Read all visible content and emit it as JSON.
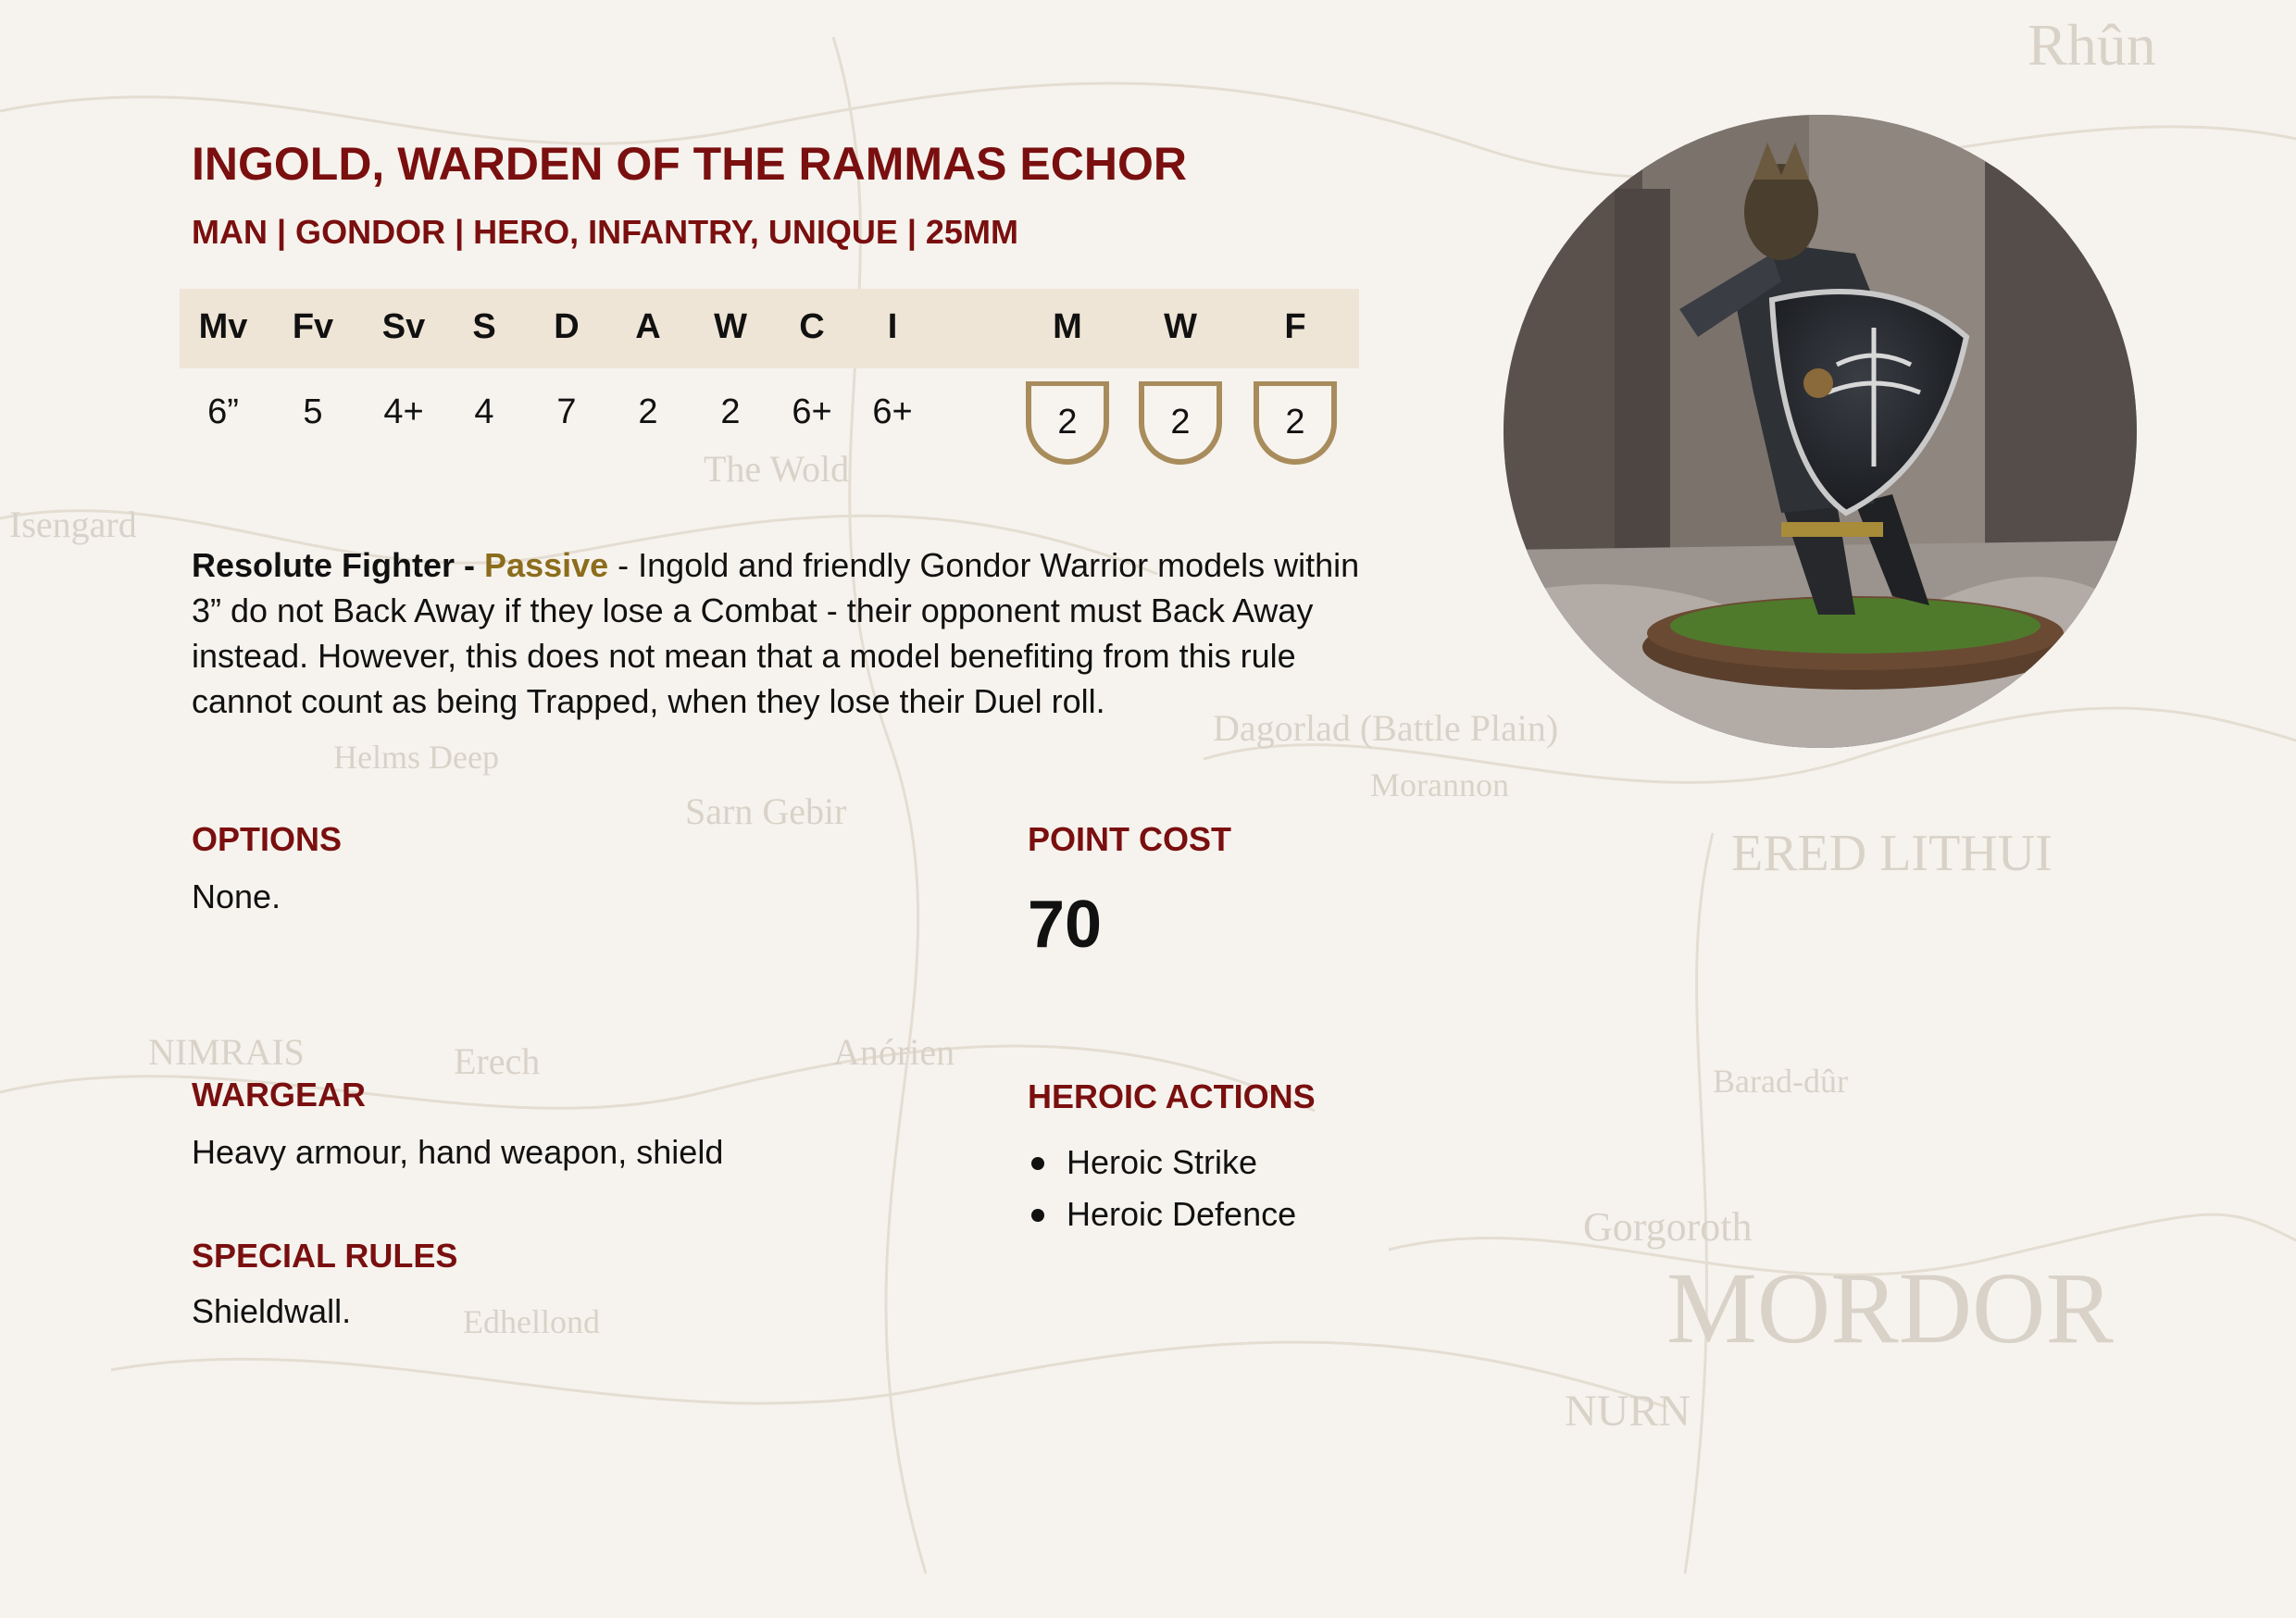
{
  "profile": {
    "name": "INGOLD, WARDEN OF THE RAMMAS ECHOR",
    "keywords": "MAN | GONDOR | HERO, INFANTRY, UNIQUE | 25MM"
  },
  "stats": {
    "headers": [
      "Mv",
      "Fv",
      "Sv",
      "S",
      "D",
      "A",
      "W",
      "C",
      "I"
    ],
    "values": [
      "6”",
      "5",
      "4+",
      "4",
      "7",
      "2",
      "2",
      "6+",
      "6+"
    ]
  },
  "heroic_stats": {
    "headers": [
      "M",
      "W",
      "F"
    ],
    "values": [
      "2",
      "2",
      "2"
    ]
  },
  "special_rule_block": {
    "name": "Resolute Fighter - ",
    "type": "Passive",
    "text": " - Ingold and friendly Gondor Warrior models within 3” do not Back Away if they lose a Combat - their opponent must Back Away instead. However, this does not mean that a model benefiting from this rule cannot count as being Trapped, when they lose their Duel roll."
  },
  "options": {
    "heading": "OPTIONS",
    "text": "None."
  },
  "point_cost": {
    "heading": "POINT COST",
    "value": "70"
  },
  "wargear": {
    "heading": "WARGEAR",
    "text": "Heavy armour, hand weapon, shield"
  },
  "heroic_actions": {
    "heading": "HEROIC ACTIONS",
    "items": [
      "Heroic Strike",
      "Heroic Defence"
    ]
  },
  "special_rules": {
    "heading": "SPECIAL RULES",
    "text": "Shieldwall."
  },
  "background_map_labels": [
    "Rhûn",
    "Isengard",
    "Dagorlad (Battle Plain)",
    "ERED LITHUI",
    "MORDOR",
    "NIMRAIS",
    "Sarn Gebir",
    "Gorgoroth",
    "NURN",
    "Edhellond",
    "Erech",
    "Helms Deep",
    "Barad-dûr",
    "Morannon",
    "The Wold",
    "Anórien"
  ],
  "colors": {
    "accent": "#7a0f0f",
    "passive": "#8c6d1c",
    "stat_bar": "#efe5d6",
    "badge_border": "#a88c5c"
  }
}
